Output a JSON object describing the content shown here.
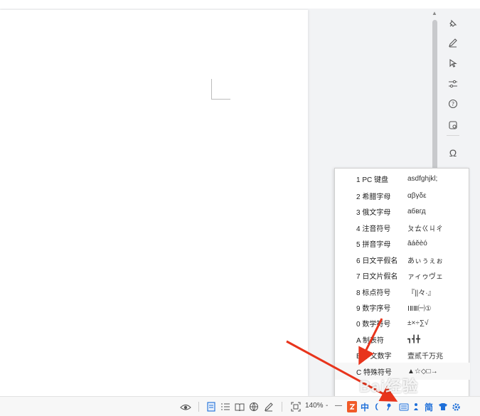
{
  "menu": {
    "items": [
      {
        "label": "1 PC 键盘",
        "sample": "asdfghjkl;"
      },
      {
        "label": "2 希腊字母",
        "sample": "αβγδε"
      },
      {
        "label": "3 俄文字母",
        "sample": "абвгд"
      },
      {
        "label": "4 注音符号",
        "sample": "ㄆㄊㄍㄐㄔ"
      },
      {
        "label": "5 拼音字母",
        "sample": "āáěèó"
      },
      {
        "label": "6 日文平假名",
        "sample": "あぃぅぇぉ"
      },
      {
        "label": "7 日文片假名",
        "sample": "ァィゥヴェ"
      },
      {
        "label": "8 标点符号",
        "sample": "『||々·』"
      },
      {
        "label": "9 数字序号",
        "sample": "ⅠⅡⅢ㈠①"
      },
      {
        "label": "0 数学符号",
        "sample": "±×÷∑√"
      },
      {
        "label": "A 制表符",
        "sample": "┓┫╋"
      },
      {
        "label": "B 中文数字",
        "sample": "壹贰千万兆"
      },
      {
        "label": "C 特殊符号",
        "sample": "▲☆◇□→"
      }
    ]
  },
  "statusbar": {
    "zoom": "140%",
    "zoom_minus": "-",
    "zoom_dash": "—",
    "ime_lang": "中",
    "ime_simplified": "简"
  },
  "watermark": "Bai经验",
  "colors": {
    "accent": "#1e6fd9",
    "arrow": "#e8341c",
    "ime_logo": "#f05a28"
  }
}
